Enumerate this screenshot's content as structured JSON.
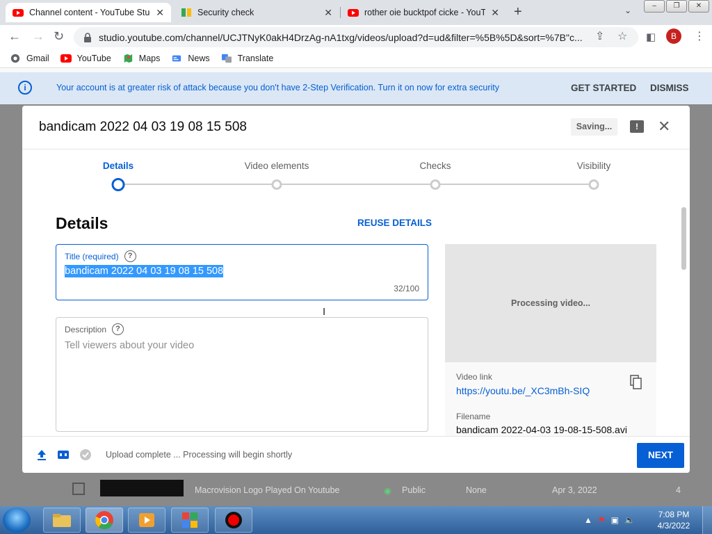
{
  "browser": {
    "tabs": [
      {
        "label": "Channel content - YouTube Studi",
        "favicon": "youtube-icon",
        "active": true
      },
      {
        "label": "Security check",
        "favicon": "security-icon",
        "active": false
      },
      {
        "label": "rother oie bucktpof cicke - YouTu",
        "favicon": "youtube-icon",
        "active": false
      }
    ],
    "tab_close": "✕",
    "new_tab": "+",
    "tab_menu": "⌄",
    "window_buttons": [
      "–",
      "❐",
      "✕"
    ],
    "url": "studio.youtube.com/channel/UCJTNyK0akH4DrzAg-nA1txg/videos/upload?d=ud&filter=%5B%5D&sort=%7B\"c...",
    "profile_initial": "B",
    "bookmarks": [
      "Gmail",
      "YouTube",
      "Maps",
      "News",
      "Translate"
    ]
  },
  "banner": {
    "message": "Your account is at greater risk of attack because you don't have 2-Step Verification. Turn it on now for extra security",
    "get_started": "GET STARTED",
    "dismiss": "DISMISS"
  },
  "background_row": {
    "title": "Macrovision Logo Played On Youtube",
    "visibility": "Public",
    "restrictions": "None",
    "date": "Apr 3, 2022",
    "count": "4"
  },
  "modal": {
    "title": "bandicam 2022 04 03 19 08 15 508",
    "saving": "Saving...",
    "steps": [
      "Details",
      "Video elements",
      "Checks",
      "Visibility"
    ],
    "active_step": 0,
    "section_title": "Details",
    "reuse": "REUSE DETAILS",
    "title_field": {
      "label": "Title (required)",
      "value": "bandicam 2022 04 03 19 08 15 508",
      "counter": "32/100"
    },
    "description_field": {
      "label": "Description",
      "placeholder": "Tell viewers about your video"
    },
    "preview": {
      "processing": "Processing video...",
      "video_link_label": "Video link",
      "video_link": "https://youtu.be/_XC3mBh-SIQ",
      "filename_label": "Filename",
      "filename": "bandicam 2022-04-03 19-08-15-508.avi"
    },
    "footer": {
      "status": "Upload complete ... Processing will begin shortly",
      "next": "NEXT"
    }
  },
  "taskbar": {
    "time": "7:08 PM",
    "date": "4/3/2022"
  },
  "colors": {
    "accent": "#065fd4",
    "banner_bg": "#dbe7f5",
    "youtube_red": "#ff0000"
  }
}
